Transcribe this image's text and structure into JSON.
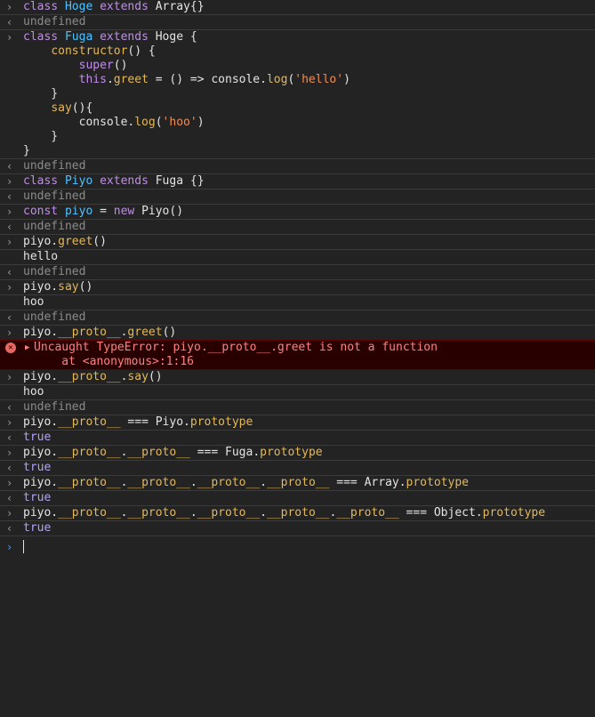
{
  "prompt_in": "›",
  "prompt_out": "‹",
  "entries": [
    {
      "input": [
        "class Hoge extends Array{}"
      ],
      "output": [
        "undefined"
      ]
    },
    {
      "input": [
        "class Fuga extends Hoge {",
        "    constructor() {",
        "        super()",
        "        this.greet = () => console.log('hello')",
        "    }",
        "    say(){",
        "        console.log('hoo')",
        "    }",
        "}"
      ],
      "output": [
        "undefined"
      ]
    },
    {
      "input": [
        "class Piyo extends Fuga {}"
      ],
      "output": [
        "undefined"
      ]
    },
    {
      "input": [
        "const piyo = new Piyo()"
      ],
      "output": [
        "undefined"
      ]
    },
    {
      "input": [
        "piyo.greet()"
      ],
      "log": "hello",
      "output": [
        "undefined"
      ]
    },
    {
      "input": [
        "piyo.say()"
      ],
      "log": "hoo",
      "output": [
        "undefined"
      ]
    },
    {
      "input": [
        "piyo.__proto__.greet()"
      ]
    },
    {
      "error": [
        "Uncaught TypeError: piyo.__proto__.greet is not a function",
        "    at <anonymous>:1:16"
      ]
    },
    {
      "input": [
        "piyo.__proto__.say()"
      ],
      "log": "hoo",
      "output": [
        "undefined"
      ]
    },
    {
      "input": [
        "piyo.__proto__ === Piyo.prototype"
      ],
      "output": [
        "true"
      ]
    },
    {
      "input": [
        "piyo.__proto__.__proto__ === Fuga.prototype"
      ],
      "output": [
        "true"
      ]
    },
    {
      "input": [
        "piyo.__proto__.__proto__.__proto__.__proto__ === Array.prototype"
      ],
      "output": [
        "true"
      ]
    },
    {
      "input": [
        "piyo.__proto__.__proto__.__proto__.__proto__.__proto__ === Object.prototype"
      ],
      "output": [
        "true"
      ]
    }
  ],
  "colors": {
    "background": "#232323",
    "keyword": "#bf8ee6",
    "class_name": "#4fc1ff",
    "method": "#e4b858",
    "string": "#f28b54",
    "boolean": "#b4a1f5",
    "error_text": "#ff8080",
    "error_bg": "#290000"
  }
}
